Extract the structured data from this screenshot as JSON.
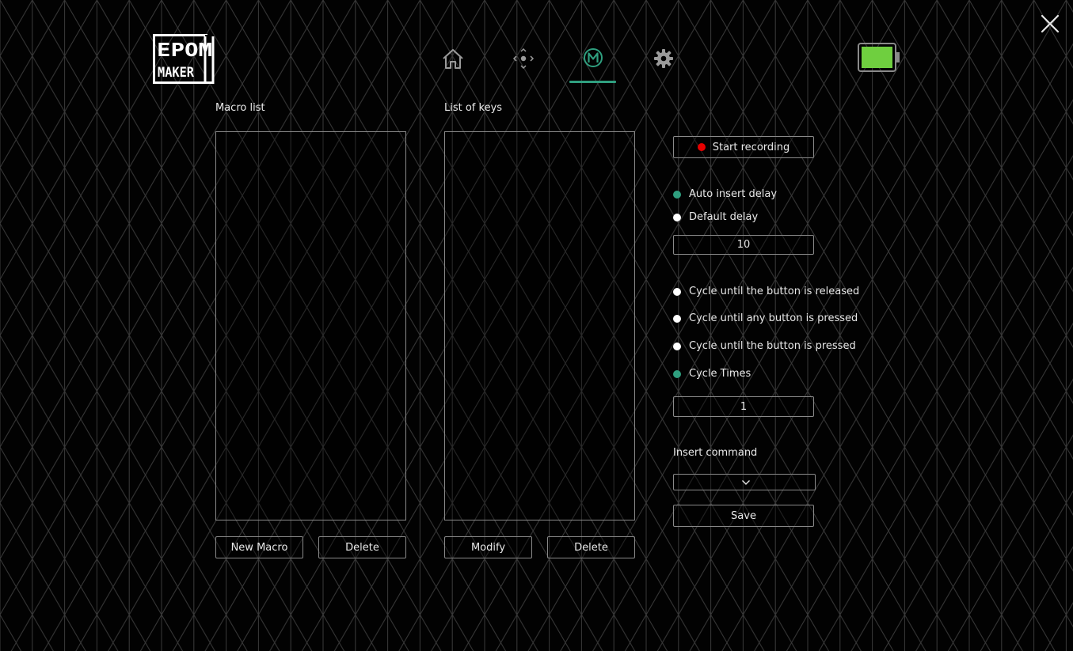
{
  "brand": {
    "logo_top": "EPOM",
    "logo_bottom": "MAKER"
  },
  "nav": {
    "items": [
      {
        "icon": "home-icon"
      },
      {
        "icon": "lighting-icon"
      },
      {
        "icon": "macro-icon",
        "active": true
      },
      {
        "icon": "gear-icon"
      }
    ]
  },
  "colors": {
    "accent": "#2f9f7f",
    "battery": "#6fcf3f",
    "record": "#e60000"
  },
  "battery_level": 1.0,
  "macro_list": {
    "title": "Macro list",
    "items": [],
    "new_label": "New Macro",
    "delete_label": "Delete"
  },
  "key_list": {
    "title": "List of keys",
    "items": [],
    "modify_label": "Modify",
    "delete_label": "Delete"
  },
  "settings": {
    "record_label": "Start recording",
    "delay_options": [
      {
        "label": "Auto insert delay",
        "selected": true
      },
      {
        "label": "Default delay",
        "selected": false
      }
    ],
    "delay_value": "10",
    "cycle_options": [
      {
        "label": "Cycle until the button is released",
        "selected": false
      },
      {
        "label": "Cycle until any button is pressed",
        "selected": false
      },
      {
        "label": "Cycle until the button is pressed",
        "selected": false
      },
      {
        "label": "Cycle Times",
        "selected": true
      }
    ],
    "cycle_times_value": "1",
    "insert_command_label": "Insert command",
    "insert_command_value": "",
    "save_label": "Save"
  }
}
